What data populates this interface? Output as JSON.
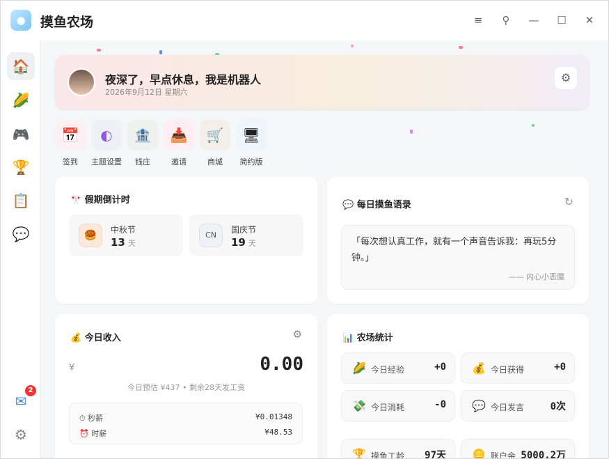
{
  "app": {
    "title": "摸鱼农场",
    "logo_icon": "fish-logo-icon"
  },
  "titlebar": {
    "menu_icon": "≡",
    "pin_icon": "⚲",
    "min_icon": "—",
    "max_icon": "☐",
    "close_icon": "✕"
  },
  "sidebar": {
    "items": [
      {
        "name": "home",
        "icon": "🏠"
      },
      {
        "name": "farm",
        "icon": "🌽"
      },
      {
        "name": "game",
        "icon": "🎮"
      },
      {
        "name": "trophy",
        "icon": "🏆"
      },
      {
        "name": "clipboard",
        "icon": "📋"
      },
      {
        "name": "chat",
        "icon": "💬"
      }
    ],
    "mail_icon": "✉",
    "mail_badge": "2",
    "settings_icon": "⚙"
  },
  "banner": {
    "greeting": "夜深了，早点休息，我是机器人",
    "date": "2026年9月12日 星期六",
    "gear": "⚙"
  },
  "quick_actions": [
    {
      "label": "签到",
      "icon": "📅",
      "bg": "#fdf0f2"
    },
    {
      "label": "主题设置",
      "icon": "◐",
      "bg": "#eef0f5"
    },
    {
      "label": "钱庄",
      "icon": "🏦",
      "bg": "#eef1ee"
    },
    {
      "label": "邀请",
      "icon": "📥",
      "bg": "#fdeef3"
    },
    {
      "label": "商城",
      "icon": "🛒",
      "bg": "#f4eee8"
    },
    {
      "label": "简约版",
      "icon": "🖥",
      "bg": "#eef4fb"
    }
  ],
  "holiday_card": {
    "title": "假期倒计时",
    "icon": "🎌",
    "items": [
      {
        "name": "中秋节",
        "days": "13",
        "unit": "天",
        "icon": "🥮"
      },
      {
        "name": "国庆节",
        "days": "19",
        "unit": "天",
        "icon": "CN"
      }
    ]
  },
  "quote_card": {
    "title": "每日摸鱼语录",
    "icon": "💬",
    "refresh": "↻",
    "text": "「每次想认真工作，就有一个声音告诉我：再玩5分钟。」",
    "author": "—— 内心小恶魔"
  },
  "income_card": {
    "title": "今日收入",
    "icon": "💰",
    "gear": "⚙",
    "currency": "¥",
    "amount": "0.00",
    "subtitle": "今日预估 ¥437 • 剩余28天发工资",
    "rows": [
      {
        "icon": "⏱",
        "label": "秒薪",
        "value": "¥0.01348"
      },
      {
        "icon": "⏰",
        "label": "时薪",
        "value": "¥48.53"
      }
    ]
  },
  "farm_card": {
    "title": "农场统计",
    "icon": "📊",
    "stats": [
      {
        "icon": "🌽",
        "label": "今日经验",
        "value": "+0"
      },
      {
        "icon": "💰",
        "label": "今日获得",
        "value": "+0"
      },
      {
        "icon": "💸",
        "label": "今日消耗",
        "value": "-0"
      },
      {
        "icon": "💬",
        "label": "今日发言",
        "value": "0次"
      },
      {
        "icon": "🏆",
        "label": "摸鱼工龄",
        "value": "97天"
      },
      {
        "icon": "🪙",
        "label": "账户余",
        "value": "5000.2万"
      }
    ]
  }
}
